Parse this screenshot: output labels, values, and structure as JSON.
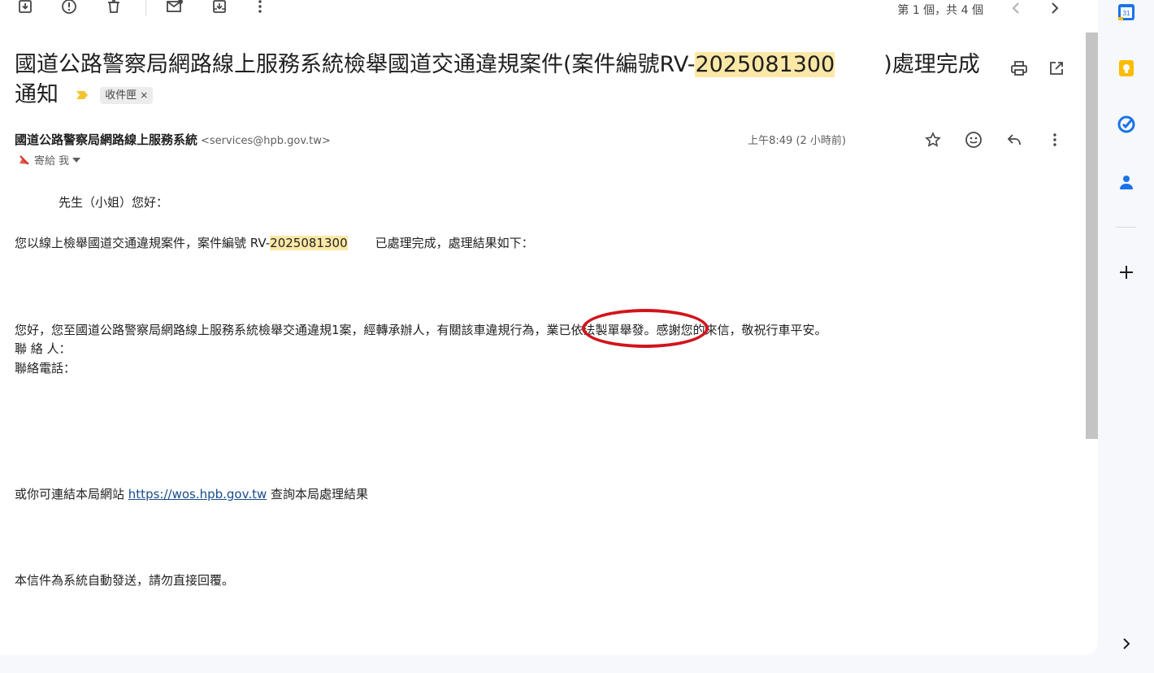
{
  "toolbar": {
    "pager": "第 1 個，共 4 個"
  },
  "subject": {
    "prefix": "國道公路警察局網路線上服務系統檢舉國道交通違規案件(案件編號RV-",
    "case_highlight": "2025081300",
    "suffix": ")處理完成通知",
    "label_chip": "收件匣",
    "label_chip_close": "×"
  },
  "sender": {
    "name": "國道公路警察局網路線上服務系統",
    "email": "<services@hpb.gov.tw>",
    "to": "寄給 我",
    "time": "上午8:49 (2 小時前)"
  },
  "body": {
    "greeting": "先生（小姐）您好：",
    "line1_prefix": "您以線上檢舉國道交通違規案件，案件編號 RV-",
    "line1_case": "2025081300",
    "line1_suffix": "已處理完成，處理結果如下：",
    "line2": "您好，您至國道公路警察局網路線上服務系統檢舉交通違規1案，經轉承辦人，有關該車違規行為，業已依法製單舉發。感謝您的來信，敬祝行車平安。",
    "contact_person": "聯 絡 人：",
    "contact_phone": "聯絡電話：",
    "link_prefix": "或你可連結本局網站",
    "link_text": "https://wos.hpb.gov.tw",
    "link_suffix": "查詢本局處理結果",
    "footer": "本信件為系統自動發送，請勿直接回覆。"
  },
  "icons": {
    "archive": "archive-icon",
    "spam": "report-spam-icon",
    "delete": "delete-icon",
    "mark_unread": "mark-unread-icon",
    "move": "move-to-icon",
    "more": "more-vert-icon",
    "prev": "chevron-left-icon",
    "next": "chevron-right-icon",
    "print": "print-icon",
    "open_new": "open-in-new-window-icon",
    "star": "star-icon",
    "emoji": "emoji-icon",
    "reply": "reply-icon",
    "calendar": "calendar-icon",
    "keep": "keep-icon",
    "tasks": "tasks-icon",
    "contacts": "contacts-icon",
    "add": "add-icon",
    "expand": "expand-panel-icon"
  },
  "colors": {
    "highlight": "#fce8a6",
    "annotation_circle": "#d2141c",
    "link": "#1a4b8c"
  }
}
